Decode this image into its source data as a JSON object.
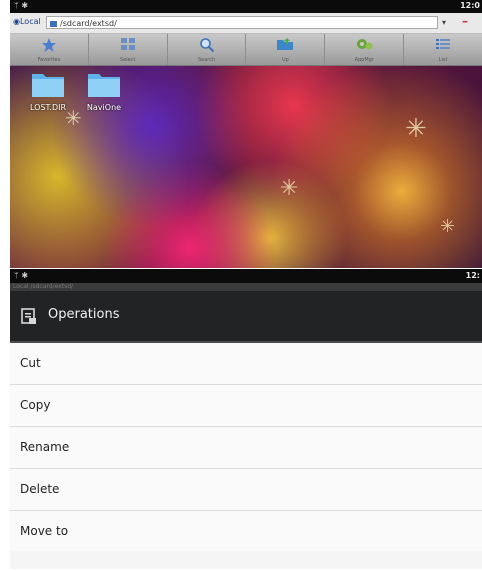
{
  "top": {
    "status": {
      "left_icons": "ᛘ ✱",
      "time": "12:0"
    },
    "address": {
      "root_label": "Local",
      "path": "/sdcard/extsd/"
    },
    "toolbar": [
      {
        "label": "Favorites",
        "icon": "star-icon"
      },
      {
        "label": "Select",
        "icon": "grid-icon"
      },
      {
        "label": "Search",
        "icon": "magnifier-icon"
      },
      {
        "label": "Up",
        "icon": "folder-up-icon"
      },
      {
        "label": "AppMgr",
        "icon": "gears-icon"
      },
      {
        "label": "List",
        "icon": "list-icon"
      }
    ],
    "files": [
      {
        "name": "LOST.DIR"
      },
      {
        "name": "NaviOne"
      }
    ]
  },
  "bottom": {
    "status": {
      "left_icons": "ᛘ ✱",
      "time": "12:"
    },
    "ghost_bar": "Local  /sdcard/extsd/",
    "dialog": {
      "title": "Operations",
      "items": [
        "Cut",
        "Copy",
        "Rename",
        "Delete",
        "Move to"
      ]
    }
  }
}
